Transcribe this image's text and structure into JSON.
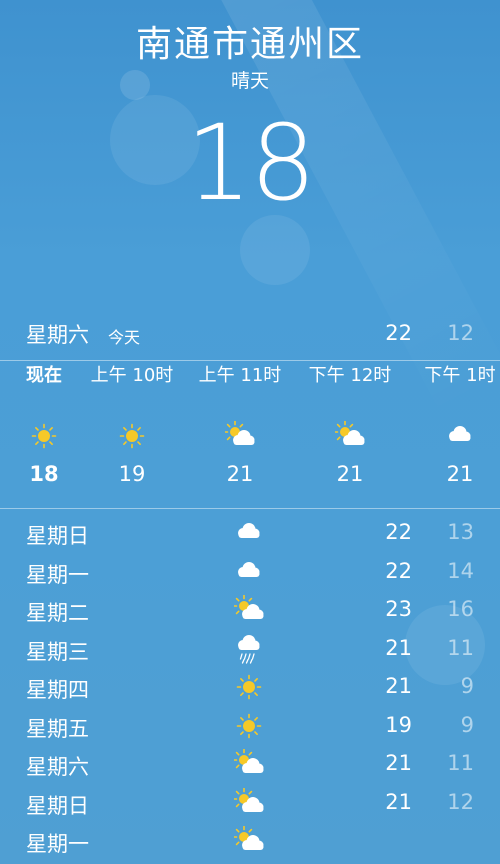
{
  "location": {
    "city": "南通市通州区",
    "condition": "晴天",
    "temperature": "18"
  },
  "today": {
    "day": "星期六",
    "label": "今天",
    "high": "22",
    "low": "12"
  },
  "hourly": [
    {
      "time": "现在",
      "icon": "sun-icon",
      "temp": "18"
    },
    {
      "time": "上午 10时",
      "icon": "sun-icon",
      "temp": "19"
    },
    {
      "time": "上午 11时",
      "icon": "partly-cloudy-icon",
      "temp": "21"
    },
    {
      "time": "下午 12时",
      "icon": "partly-cloudy-icon",
      "temp": "21"
    },
    {
      "time": "下午 1时",
      "icon": "cloud-icon",
      "temp": "21"
    }
  ],
  "daily": [
    {
      "day": "星期日",
      "icon": "cloud-icon",
      "high": "22",
      "low": "13"
    },
    {
      "day": "星期一",
      "icon": "cloud-icon",
      "high": "22",
      "low": "14"
    },
    {
      "day": "星期二",
      "icon": "partly-cloudy-icon",
      "high": "23",
      "low": "16"
    },
    {
      "day": "星期三",
      "icon": "rain-cloud-icon",
      "high": "21",
      "low": "11"
    },
    {
      "day": "星期四",
      "icon": "sun-icon",
      "high": "21",
      "low": "9"
    },
    {
      "day": "星期五",
      "icon": "sun-icon",
      "high": "19",
      "low": "9"
    },
    {
      "day": "星期六",
      "icon": "partly-cloudy-icon",
      "high": "21",
      "low": "11"
    },
    {
      "day": "星期日",
      "icon": "partly-cloudy-icon",
      "high": "21",
      "low": "12"
    },
    {
      "day": "星期一",
      "icon": "partly-cloudy-icon",
      "high": "",
      "low": ""
    }
  ],
  "colors": {
    "background": "#4a9ed7",
    "sun": "#f6c928",
    "text": "#ffffff"
  }
}
